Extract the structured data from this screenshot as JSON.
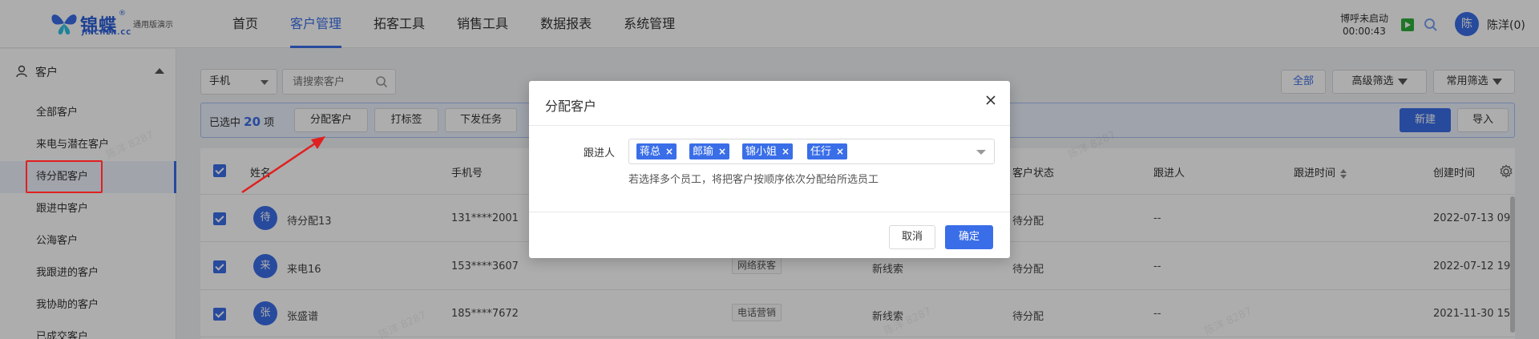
{
  "colors": {
    "accent": "#3a6ee8",
    "highlight_box": "#e02020",
    "play_green": "#2fae3b"
  },
  "header": {
    "logo_brand": "锦蝶",
    "logo_registered": "®",
    "logo_sub": "JINCHEN.CC",
    "logo_tag": "通用版演示",
    "nav": [
      "首页",
      "客户管理",
      "拓客工具",
      "销售工具",
      "数据报表",
      "系统管理"
    ],
    "active_nav": "客户管理",
    "call_status": "博呼未启动",
    "call_timer": "00:00:43",
    "avatar_char": "陈",
    "user_name": "陈洋(0)"
  },
  "sidebar": {
    "group_label": "客户",
    "items": [
      "全部客户",
      "来电与潜在客户",
      "待分配客户",
      "跟进中客户",
      "公海客户",
      "我跟进的客户",
      "我协助的客户",
      "已成交客户"
    ],
    "active_item": "待分配客户"
  },
  "toolbar": {
    "field_select": "手机",
    "search_placeholder": "请搜索客户",
    "all_label": "全部",
    "advanced_filter": "高级筛选",
    "common_filter": "常用筛选"
  },
  "selection_bar": {
    "prefix": "已选中",
    "count": "20",
    "suffix": "项",
    "assign": "分配客户",
    "tag": "打标签",
    "task": "下发任务",
    "new": "新建",
    "import": "导入"
  },
  "table": {
    "headers": {
      "name": "姓名",
      "phone": "手机号",
      "status": "客户状态",
      "follower": "跟进人",
      "follow_time": "跟进时间",
      "created": "创建时间"
    },
    "rows": [
      {
        "avatar": "待",
        "name": "待分配13",
        "phone": "131****2001",
        "source": "",
        "stage": "",
        "status": "待分配",
        "follower": "--",
        "created": "2022-07-13 09"
      },
      {
        "avatar": "来",
        "name": "来电16",
        "phone": "153****3607",
        "source": "网络获客",
        "stage": "新线索",
        "status": "待分配",
        "follower": "--",
        "created": "2022-07-12 19"
      },
      {
        "avatar": "张",
        "name": "张盛谱",
        "phone": "185****7672",
        "source": "电话营销",
        "stage": "新线索",
        "status": "待分配",
        "follower": "--",
        "created": "2021-11-30 15"
      }
    ]
  },
  "watermark": "陈洋 8287",
  "modal": {
    "title": "分配客户",
    "field_label": "跟进人",
    "chips": [
      "蒋总",
      "郎瑜",
      "锦小姐",
      "任行"
    ],
    "hint": "若选择多个员工，将把客户按顺序依次分配给所选员工",
    "cancel": "取消",
    "ok": "确定"
  }
}
